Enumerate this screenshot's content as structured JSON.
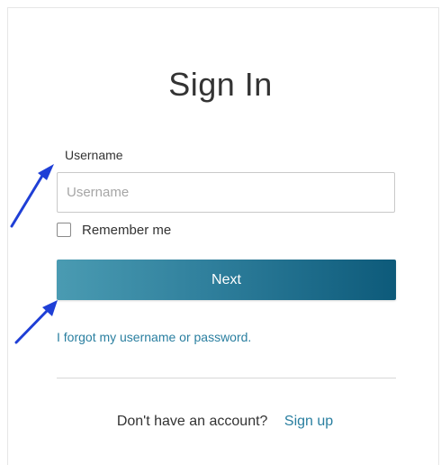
{
  "page": {
    "title": "Sign In"
  },
  "form": {
    "username_label": "Username",
    "username_placeholder": "Username",
    "username_value": "",
    "remember_label": "Remember me",
    "remember_checked": false,
    "next_label": "Next",
    "forgot_link": "I forgot my username or password."
  },
  "footer": {
    "signup_prompt": "Don't have an account?",
    "signup_link": "Sign up"
  },
  "annotations": {
    "arrow_color": "#1f3fd6",
    "arrow_icon": "arrow-up-right-icon"
  },
  "colors": {
    "button_gradient_start": "#4a9bb2",
    "button_gradient_end": "#0d5a7a",
    "link": "#2a7fa0",
    "text": "#333333"
  }
}
